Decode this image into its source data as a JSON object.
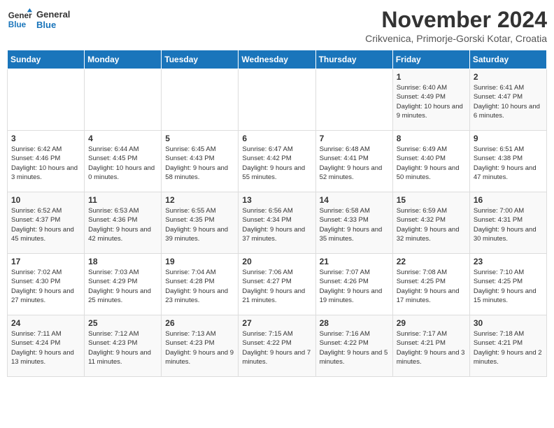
{
  "header": {
    "logo_general": "General",
    "logo_blue": "Blue",
    "month_title": "November 2024",
    "subtitle": "Crikvenica, Primorje-Gorski Kotar, Croatia"
  },
  "days_of_week": [
    "Sunday",
    "Monday",
    "Tuesday",
    "Wednesday",
    "Thursday",
    "Friday",
    "Saturday"
  ],
  "weeks": [
    [
      {
        "num": "",
        "info": ""
      },
      {
        "num": "",
        "info": ""
      },
      {
        "num": "",
        "info": ""
      },
      {
        "num": "",
        "info": ""
      },
      {
        "num": "",
        "info": ""
      },
      {
        "num": "1",
        "info": "Sunrise: 6:40 AM\nSunset: 4:49 PM\nDaylight: 10 hours and 9 minutes."
      },
      {
        "num": "2",
        "info": "Sunrise: 6:41 AM\nSunset: 4:47 PM\nDaylight: 10 hours and 6 minutes."
      }
    ],
    [
      {
        "num": "3",
        "info": "Sunrise: 6:42 AM\nSunset: 4:46 PM\nDaylight: 10 hours and 3 minutes."
      },
      {
        "num": "4",
        "info": "Sunrise: 6:44 AM\nSunset: 4:45 PM\nDaylight: 10 hours and 0 minutes."
      },
      {
        "num": "5",
        "info": "Sunrise: 6:45 AM\nSunset: 4:43 PM\nDaylight: 9 hours and 58 minutes."
      },
      {
        "num": "6",
        "info": "Sunrise: 6:47 AM\nSunset: 4:42 PM\nDaylight: 9 hours and 55 minutes."
      },
      {
        "num": "7",
        "info": "Sunrise: 6:48 AM\nSunset: 4:41 PM\nDaylight: 9 hours and 52 minutes."
      },
      {
        "num": "8",
        "info": "Sunrise: 6:49 AM\nSunset: 4:40 PM\nDaylight: 9 hours and 50 minutes."
      },
      {
        "num": "9",
        "info": "Sunrise: 6:51 AM\nSunset: 4:38 PM\nDaylight: 9 hours and 47 minutes."
      }
    ],
    [
      {
        "num": "10",
        "info": "Sunrise: 6:52 AM\nSunset: 4:37 PM\nDaylight: 9 hours and 45 minutes."
      },
      {
        "num": "11",
        "info": "Sunrise: 6:53 AM\nSunset: 4:36 PM\nDaylight: 9 hours and 42 minutes."
      },
      {
        "num": "12",
        "info": "Sunrise: 6:55 AM\nSunset: 4:35 PM\nDaylight: 9 hours and 39 minutes."
      },
      {
        "num": "13",
        "info": "Sunrise: 6:56 AM\nSunset: 4:34 PM\nDaylight: 9 hours and 37 minutes."
      },
      {
        "num": "14",
        "info": "Sunrise: 6:58 AM\nSunset: 4:33 PM\nDaylight: 9 hours and 35 minutes."
      },
      {
        "num": "15",
        "info": "Sunrise: 6:59 AM\nSunset: 4:32 PM\nDaylight: 9 hours and 32 minutes."
      },
      {
        "num": "16",
        "info": "Sunrise: 7:00 AM\nSunset: 4:31 PM\nDaylight: 9 hours and 30 minutes."
      }
    ],
    [
      {
        "num": "17",
        "info": "Sunrise: 7:02 AM\nSunset: 4:30 PM\nDaylight: 9 hours and 27 minutes."
      },
      {
        "num": "18",
        "info": "Sunrise: 7:03 AM\nSunset: 4:29 PM\nDaylight: 9 hours and 25 minutes."
      },
      {
        "num": "19",
        "info": "Sunrise: 7:04 AM\nSunset: 4:28 PM\nDaylight: 9 hours and 23 minutes."
      },
      {
        "num": "20",
        "info": "Sunrise: 7:06 AM\nSunset: 4:27 PM\nDaylight: 9 hours and 21 minutes."
      },
      {
        "num": "21",
        "info": "Sunrise: 7:07 AM\nSunset: 4:26 PM\nDaylight: 9 hours and 19 minutes."
      },
      {
        "num": "22",
        "info": "Sunrise: 7:08 AM\nSunset: 4:25 PM\nDaylight: 9 hours and 17 minutes."
      },
      {
        "num": "23",
        "info": "Sunrise: 7:10 AM\nSunset: 4:25 PM\nDaylight: 9 hours and 15 minutes."
      }
    ],
    [
      {
        "num": "24",
        "info": "Sunrise: 7:11 AM\nSunset: 4:24 PM\nDaylight: 9 hours and 13 minutes."
      },
      {
        "num": "25",
        "info": "Sunrise: 7:12 AM\nSunset: 4:23 PM\nDaylight: 9 hours and 11 minutes."
      },
      {
        "num": "26",
        "info": "Sunrise: 7:13 AM\nSunset: 4:23 PM\nDaylight: 9 hours and 9 minutes."
      },
      {
        "num": "27",
        "info": "Sunrise: 7:15 AM\nSunset: 4:22 PM\nDaylight: 9 hours and 7 minutes."
      },
      {
        "num": "28",
        "info": "Sunrise: 7:16 AM\nSunset: 4:22 PM\nDaylight: 9 hours and 5 minutes."
      },
      {
        "num": "29",
        "info": "Sunrise: 7:17 AM\nSunset: 4:21 PM\nDaylight: 9 hours and 3 minutes."
      },
      {
        "num": "30",
        "info": "Sunrise: 7:18 AM\nSunset: 4:21 PM\nDaylight: 9 hours and 2 minutes."
      }
    ]
  ]
}
